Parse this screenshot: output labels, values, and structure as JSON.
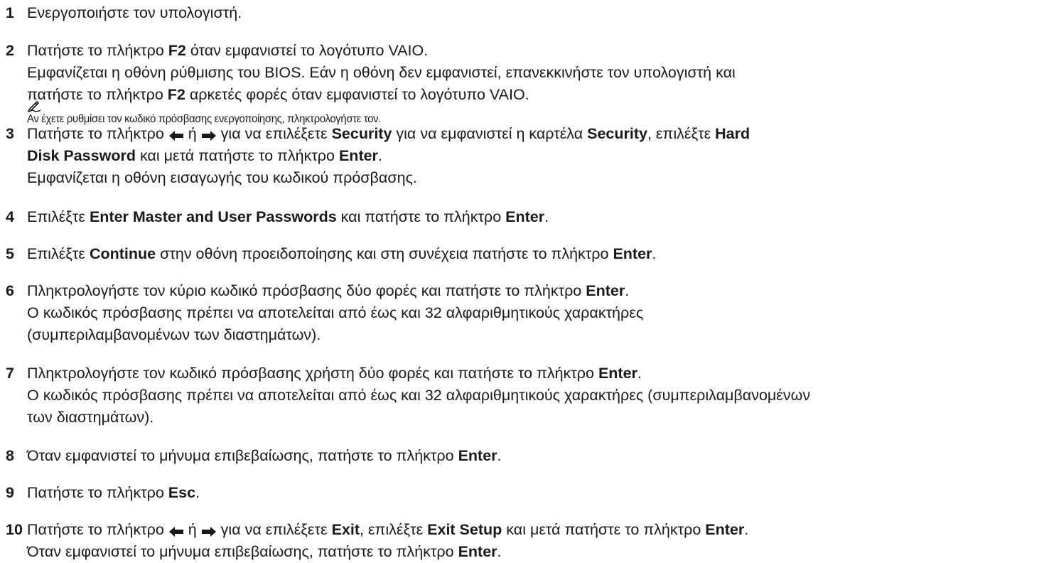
{
  "steps": [
    {
      "num": "1",
      "lines": [
        [
          {
            "t": "Ενεργοποιήστε τον υπολογιστή."
          }
        ]
      ]
    },
    {
      "num": "2",
      "lines": [
        [
          {
            "t": "Πατήστε το πλήκτρο "
          },
          {
            "t": "F2",
            "b": true
          },
          {
            "t": " όταν εμφανιστεί το λογότυπο VAIO."
          }
        ],
        [
          {
            "t": "Εμφανίζεται η οθόνη ρύθμισης του BIOS. Εάν η οθόνη δεν εμφανιστεί, επανεκκινήστε τον υπολογιστή και"
          }
        ],
        [
          {
            "t": "πατήστε το πλήκτρο "
          },
          {
            "t": "F2",
            "b": true
          },
          {
            "t": " αρκετές φορές όταν εμφανιστεί το λογότυπο VAIO."
          }
        ]
      ]
    },
    {
      "num": "3",
      "lines": [
        [
          {
            "t": "Πατήστε το πλήκτρο "
          },
          {
            "icon": "left-arrow-icon"
          },
          {
            "t": " ή "
          },
          {
            "icon": "right-arrow-icon"
          },
          {
            "t": " για να επιλέξετε "
          },
          {
            "t": "Security",
            "b": true
          },
          {
            "t": " για να εμφανιστεί η καρτέλα "
          },
          {
            "t": "Security",
            "b": true
          },
          {
            "t": ", επιλέξτε "
          },
          {
            "t": "Hard",
            "b": true
          }
        ],
        [
          {
            "t": "Disk Password",
            "b": true
          },
          {
            "t": " και μετά πατήστε το πλήκτρο "
          },
          {
            "t": "Enter",
            "b": true
          },
          {
            "t": "."
          }
        ],
        [
          {
            "t": "Εμφανίζεται η οθόνη εισαγωγής του κωδικού πρόσβασης."
          }
        ]
      ]
    },
    {
      "num": "4",
      "lines": [
        [
          {
            "t": "Επιλέξτε "
          },
          {
            "t": "Enter Master and User Passwords",
            "b": true
          },
          {
            "t": " και πατήστε το πλήκτρο "
          },
          {
            "t": "Enter",
            "b": true
          },
          {
            "t": "."
          }
        ]
      ]
    },
    {
      "num": "5",
      "lines": [
        [
          {
            "t": "Επιλέξτε "
          },
          {
            "t": "Continue",
            "b": true
          },
          {
            "t": " στην οθόνη προειδοποίησης και στη συνέχεια πατήστε το πλήκτρο "
          },
          {
            "t": "Enter",
            "b": true
          },
          {
            "t": "."
          }
        ]
      ]
    },
    {
      "num": "6",
      "lines": [
        [
          {
            "t": "Πληκτρολογήστε τον κύριο κωδικό πρόσβασης δύο φορές και πατήστε το πλήκτρο "
          },
          {
            "t": "Enter",
            "b": true
          },
          {
            "t": "."
          }
        ],
        [
          {
            "t": "Ο κωδικός πρόσβασης πρέπει να αποτελείται από έως και 32 αλφαριθμητικούς χαρακτήρες"
          }
        ],
        [
          {
            "t": "(συμπεριλαμβανομένων των διαστημάτων)."
          }
        ]
      ]
    },
    {
      "num": "7",
      "lines": [
        [
          {
            "t": "Πληκτρολογήστε τον κωδικό πρόσβασης χρήστη δύο φορές και πατήστε το πλήκτρο "
          },
          {
            "t": "Enter",
            "b": true
          },
          {
            "t": "."
          }
        ],
        [
          {
            "t": "Ο κωδικός πρόσβασης πρέπει να αποτελείται από έως και 32 αλφαριθμητικούς χαρακτήρες (συμπεριλαμβανομένων"
          }
        ],
        [
          {
            "t": "των διαστημάτων)."
          }
        ]
      ]
    },
    {
      "num": "8",
      "lines": [
        [
          {
            "t": "Όταν εμφανιστεί το μήνυμα επιβεβαίωσης, πατήστε το πλήκτρο "
          },
          {
            "t": "Enter",
            "b": true
          },
          {
            "t": "."
          }
        ]
      ]
    },
    {
      "num": "9",
      "lines": [
        [
          {
            "t": "Πατήστε το πλήκτρο "
          },
          {
            "t": "Esc",
            "b": true
          },
          {
            "t": "."
          }
        ]
      ]
    },
    {
      "num": "10",
      "lines": [
        [
          {
            "t": "Πατήστε το πλήκτρο "
          },
          {
            "icon": "left-arrow-icon"
          },
          {
            "t": " ή "
          },
          {
            "icon": "right-arrow-icon"
          },
          {
            "t": " για να επιλέξετε "
          },
          {
            "t": "Exit",
            "b": true
          },
          {
            "t": ", επιλέξτε "
          },
          {
            "t": "Exit Setup",
            "b": true
          },
          {
            "t": " και μετά πατήστε το πλήκτρο "
          },
          {
            "t": "Enter",
            "b": true
          },
          {
            "t": "."
          }
        ],
        [
          {
            "t": "Όταν εμφανιστεί το μήνυμα επιβεβαίωσης, πατήστε το πλήκτρο "
          },
          {
            "t": "Enter",
            "b": true
          },
          {
            "t": "."
          }
        ]
      ]
    }
  ],
  "note": {
    "icon": "pencil-note-icon",
    "text": "Αν έχετε ρυθμίσει τον κωδικό πρόσβασης ενεργοποίησης, πληκτρολογήστε τον."
  }
}
